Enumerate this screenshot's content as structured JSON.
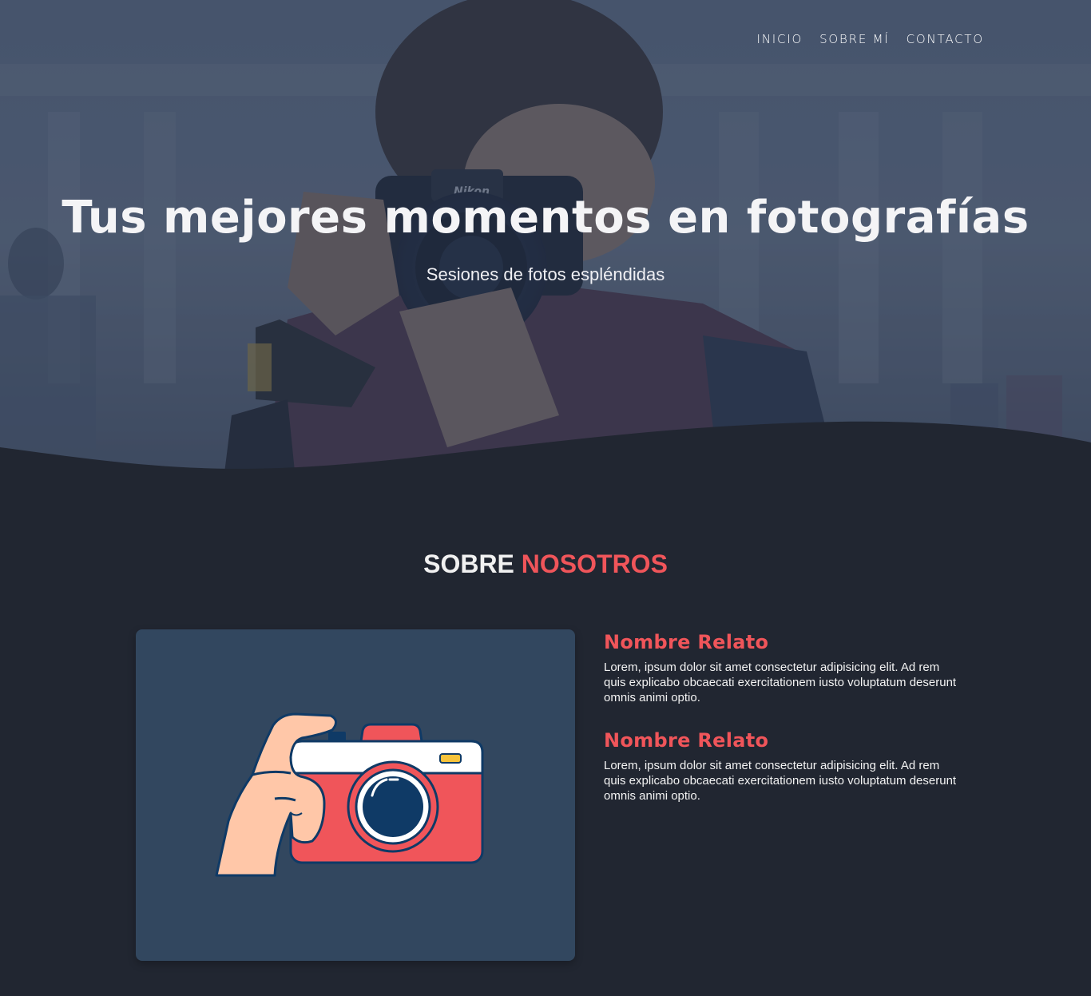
{
  "nav": {
    "items": [
      {
        "label": "INICIO"
      },
      {
        "label": "SOBRE MÍ"
      },
      {
        "label": "CONTACTO"
      }
    ]
  },
  "hero": {
    "title": "Tus mejores momentos en fotografías",
    "subtitle": "Sesiones de fotos espléndidas"
  },
  "about": {
    "title_part1": "SOBRE",
    "title_part2": "NOSOTROS",
    "stories": [
      {
        "title": "Nombre Relato",
        "text": "Lorem, ipsum dolor sit amet consectetur adipisicing elit. Ad rem quis explicabo obcaecati exercitationem iusto voluptatum deserunt omnis animi optio."
      },
      {
        "title": "Nombre Relato",
        "text": "Lorem, ipsum dolor sit amet consectetur adipisicing elit. Ad rem quis explicabo obcaecati exercitationem iusto voluptatum deserunt omnis animi optio."
      }
    ]
  },
  "colors": {
    "accent": "#f0555a",
    "background": "#212631",
    "card": "#32475f"
  },
  "icons": {
    "illustration": "camera-hand-illustration",
    "hero_image": "photographer-photo"
  }
}
